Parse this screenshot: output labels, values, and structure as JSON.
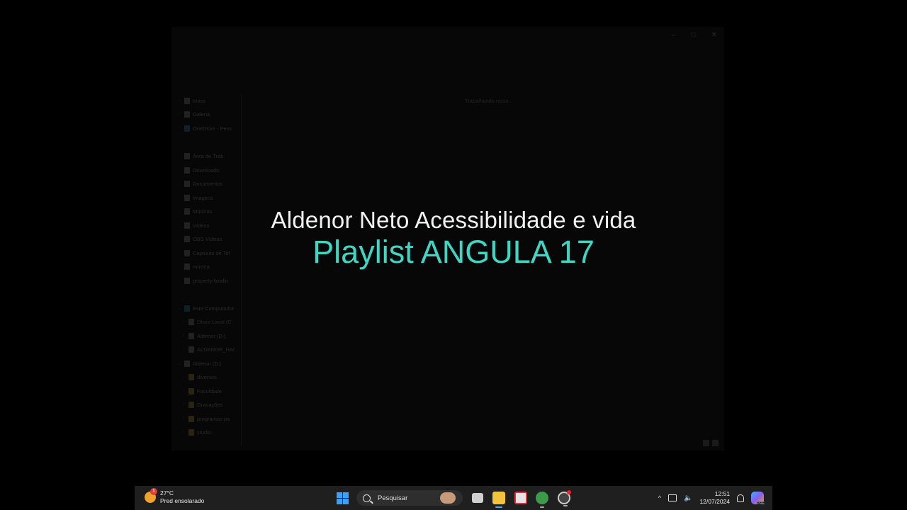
{
  "explorer": {
    "window_controls": [
      "–",
      "□",
      "✕"
    ],
    "status_text": "Trabalhando nisso...",
    "nav_items": [
      {
        "label": "Início",
        "icon": "home-icon",
        "type": "item"
      },
      {
        "label": "Galeria",
        "icon": "gallery-icon",
        "type": "item"
      },
      {
        "label": "OneDrive - Pess",
        "icon": "cloud-icon",
        "type": "item"
      },
      {
        "label": "Área de Trab",
        "icon": "desktop-icon",
        "type": "pinned"
      },
      {
        "label": "Downloads",
        "icon": "download-icon",
        "type": "pinned"
      },
      {
        "label": "Documentos",
        "icon": "document-icon",
        "type": "pinned"
      },
      {
        "label": "Imagens",
        "icon": "image-icon",
        "type": "pinned"
      },
      {
        "label": "Músicas",
        "icon": "music-icon",
        "type": "pinned"
      },
      {
        "label": "Vídeos",
        "icon": "video-icon",
        "type": "pinned"
      },
      {
        "label": "OBS Vídeos",
        "icon": "folder-icon",
        "type": "item"
      },
      {
        "label": "Capturas de Tel",
        "icon": "folder-icon",
        "type": "item"
      },
      {
        "label": "música",
        "icon": "folder-icon",
        "type": "item"
      },
      {
        "label": "property-bindin",
        "icon": "folder-icon",
        "type": "item"
      },
      {
        "label": "Este Computador",
        "icon": "computer-icon",
        "type": "item"
      },
      {
        "label": "Disco Local (C:",
        "icon": "drive-icon",
        "type": "item"
      },
      {
        "label": "Aldenor (D:)",
        "icon": "drive-icon",
        "type": "item"
      },
      {
        "label": "ALDENOR_HAI",
        "icon": "drive-icon",
        "type": "item"
      },
      {
        "label": "Aldenor (D:)",
        "icon": "drive-icon",
        "type": "item"
      },
      {
        "label": "diversos",
        "icon": "folder-icon",
        "type": "folder"
      },
      {
        "label": "Faculdade",
        "icon": "folder-icon",
        "type": "folder"
      },
      {
        "label": "Gravações",
        "icon": "folder-icon",
        "type": "folder"
      },
      {
        "label": "programas pa",
        "icon": "folder-icon",
        "type": "folder"
      },
      {
        "label": "studio",
        "icon": "folder-icon",
        "type": "folder"
      }
    ]
  },
  "overlay": {
    "line1": "Aldenor Neto Acessibilidade e vida",
    "line2": "Playlist ANGULA 17",
    "line2_color": "#3fd6c4"
  },
  "taskbar": {
    "weather": {
      "temp": "27°C",
      "desc": "Pred ensolarado",
      "badge": "1"
    },
    "search_placeholder": "Pesquisar",
    "apps": [
      "task-view-icon",
      "file-explorer-icon",
      "document-app-icon",
      "chrome-icon",
      "obs-icon"
    ],
    "tray": {
      "time": "12:51",
      "date": "12/07/2024",
      "copilot_badge": "PRE"
    }
  }
}
